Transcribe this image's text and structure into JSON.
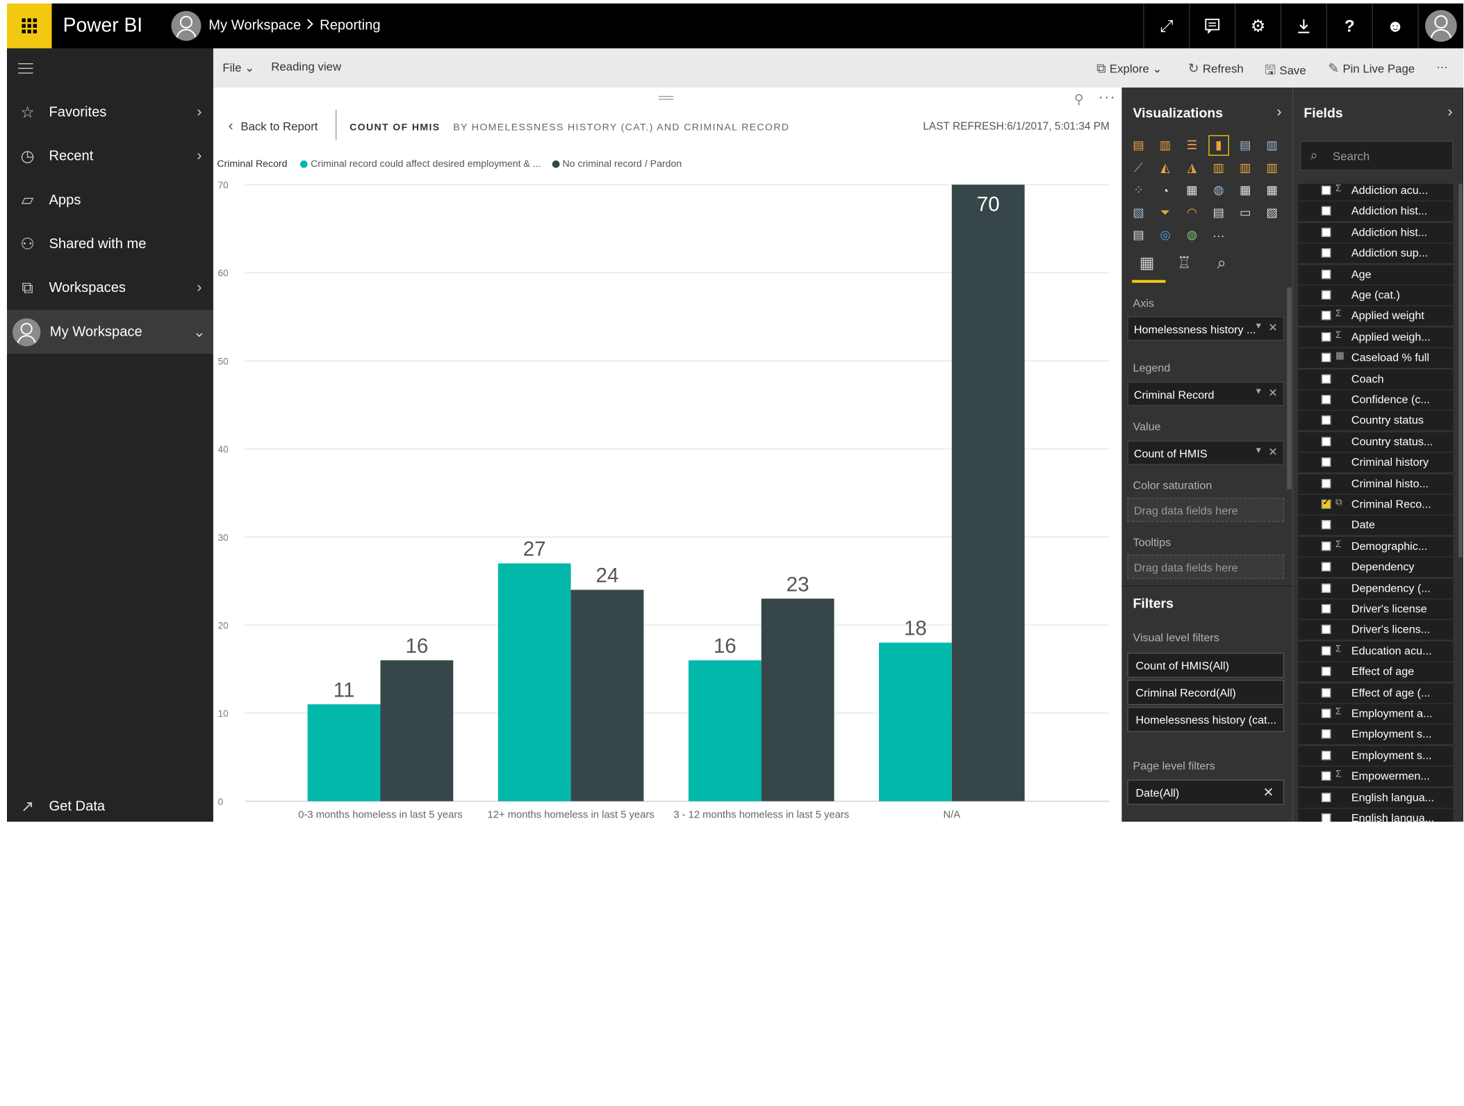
{
  "topbar": {
    "brand": "Power BI",
    "workspace": "My Workspace",
    "separator": ">",
    "page": "Reporting",
    "icons": [
      "expand-icon",
      "comment-icon",
      "gear-icon",
      "download-icon",
      "help-icon",
      "smiley-icon",
      "user-avatar"
    ]
  },
  "leftnav": {
    "items": [
      {
        "label": "Favorites",
        "icon": "star-icon"
      },
      {
        "label": "Recent",
        "icon": "clock-icon"
      },
      {
        "label": "Apps",
        "icon": "apps-icon"
      },
      {
        "label": "Shared with me",
        "icon": "shared-icon"
      },
      {
        "label": "Workspaces",
        "icon": "workspaces-icon"
      },
      {
        "label": "My Workspace",
        "icon": "avatar"
      }
    ],
    "get_data": "Get Data"
  },
  "cmdbar": {
    "file": "File",
    "reading_view": "Reading view",
    "explore": "Explore",
    "refresh": "Refresh",
    "save": "Save",
    "pin_live_page": "Pin Live Page",
    "more": "···"
  },
  "visual": {
    "back": "Back to Report",
    "title": "COUNT OF HMIS",
    "subtitle": "BY HOMELESSNESS HISTORY (CAT.) AND CRIMINAL RECORD",
    "last_refresh": "LAST REFRESH:6/1/2017, 5:01:34 PM",
    "legend_title": "Criminal Record"
  },
  "chart_data": {
    "type": "bar",
    "categories": [
      "0-3 months homeless in last 5 years",
      "12+ months homeless in last 5 years",
      "3 - 12 months homeless in last 5 years",
      "N/A"
    ],
    "series": [
      {
        "name": "Criminal record could affect desired employment & ...",
        "color": "#01b8aa",
        "values": [
          11,
          27,
          16,
          18
        ]
      },
      {
        "name": "No criminal record / Pardon",
        "color": "#374649",
        "values": [
          16,
          24,
          23,
          70
        ]
      }
    ],
    "y_ticks": [
      0,
      10,
      20,
      30,
      40,
      50,
      60,
      70
    ],
    "ylim": [
      0,
      70
    ],
    "grid": true,
    "legend": "top-left"
  },
  "viz": {
    "title": "Visualizations",
    "axis_label": "Axis",
    "axis_value": "Homelessness history ...",
    "legend_label": "Legend",
    "legend_value": "Criminal Record",
    "value_label": "Value",
    "value_value": "Count of HMIS",
    "color_label": "Color saturation",
    "color_placeholder": "Drag data fields here",
    "tooltips_label": "Tooltips",
    "tooltips_placeholder": "Drag data fields here",
    "filters_title": "Filters",
    "visual_filters_label": "Visual level filters",
    "visual_filters": [
      "Count of HMIS(All)",
      "Criminal Record(All)",
      "Homelessness history (cat..."
    ],
    "page_filters_label": "Page level filters",
    "page_filters": [
      "Date(All)"
    ]
  },
  "fields": {
    "title": "Fields",
    "search_placeholder": "Search",
    "items": [
      {
        "name": "Addiction acu...",
        "type": "Σ"
      },
      {
        "name": "Addiction hist...",
        "type": ""
      },
      {
        "name": "Addiction hist...",
        "type": ""
      },
      {
        "name": "Addiction sup...",
        "type": ""
      },
      {
        "name": "Age",
        "type": ""
      },
      {
        "name": "Age (cat.)",
        "type": ""
      },
      {
        "name": "Applied weight",
        "type": "Σ"
      },
      {
        "name": "Applied weigh...",
        "type": "Σ"
      },
      {
        "name": "Caseload % full",
        "type": "▦"
      },
      {
        "name": "Coach",
        "type": ""
      },
      {
        "name": "Confidence (c...",
        "type": ""
      },
      {
        "name": "Country status",
        "type": ""
      },
      {
        "name": "Country status...",
        "type": ""
      },
      {
        "name": "Criminal history",
        "type": ""
      },
      {
        "name": "Criminal histo...",
        "type": ""
      },
      {
        "name": "Criminal Reco...",
        "type": "⧉",
        "checked": true
      },
      {
        "name": "Date",
        "type": ""
      },
      {
        "name": "Demographic...",
        "type": "Σ"
      },
      {
        "name": "Dependency",
        "type": ""
      },
      {
        "name": "Dependency (...",
        "type": ""
      },
      {
        "name": "Driver's license",
        "type": ""
      },
      {
        "name": "Driver's licens...",
        "type": ""
      },
      {
        "name": "Education acu...",
        "type": "Σ"
      },
      {
        "name": "Effect of age",
        "type": ""
      },
      {
        "name": "Effect of age (...",
        "type": ""
      },
      {
        "name": "Employment a...",
        "type": "Σ"
      },
      {
        "name": "Employment s...",
        "type": ""
      },
      {
        "name": "Employment s...",
        "type": ""
      },
      {
        "name": "Empowermen...",
        "type": "Σ"
      },
      {
        "name": "English langua...",
        "type": ""
      },
      {
        "name": "English langua...",
        "type": ""
      }
    ]
  }
}
